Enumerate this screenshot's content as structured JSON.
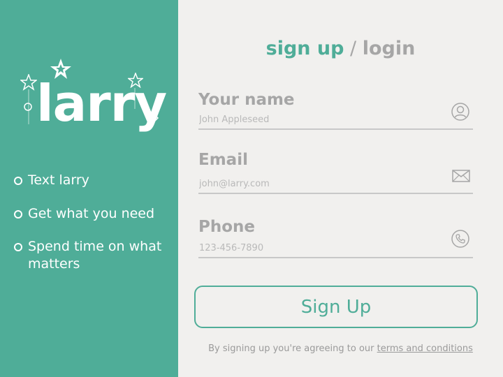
{
  "brand": {
    "logo_text": "larry",
    "accent_color": "#4fad98"
  },
  "features": [
    "Text larry",
    "Get what you need",
    "Spend time on what matters"
  ],
  "auth": {
    "signup_tab": "sign up",
    "separator": " / ",
    "login_tab": "login"
  },
  "form": {
    "name": {
      "label": "Your name",
      "placeholder": "John Appleseed",
      "icon": "user-icon"
    },
    "email": {
      "label": "Email",
      "placeholder": "john@larry.com",
      "icon": "envelope-icon"
    },
    "phone": {
      "label": "Phone",
      "placeholder": "123-456-7890",
      "icon": "phone-icon"
    },
    "submit_label": "Sign Up"
  },
  "terms": {
    "prefix": "By signing up you're agreeing to our ",
    "link": "terms and conditions"
  }
}
